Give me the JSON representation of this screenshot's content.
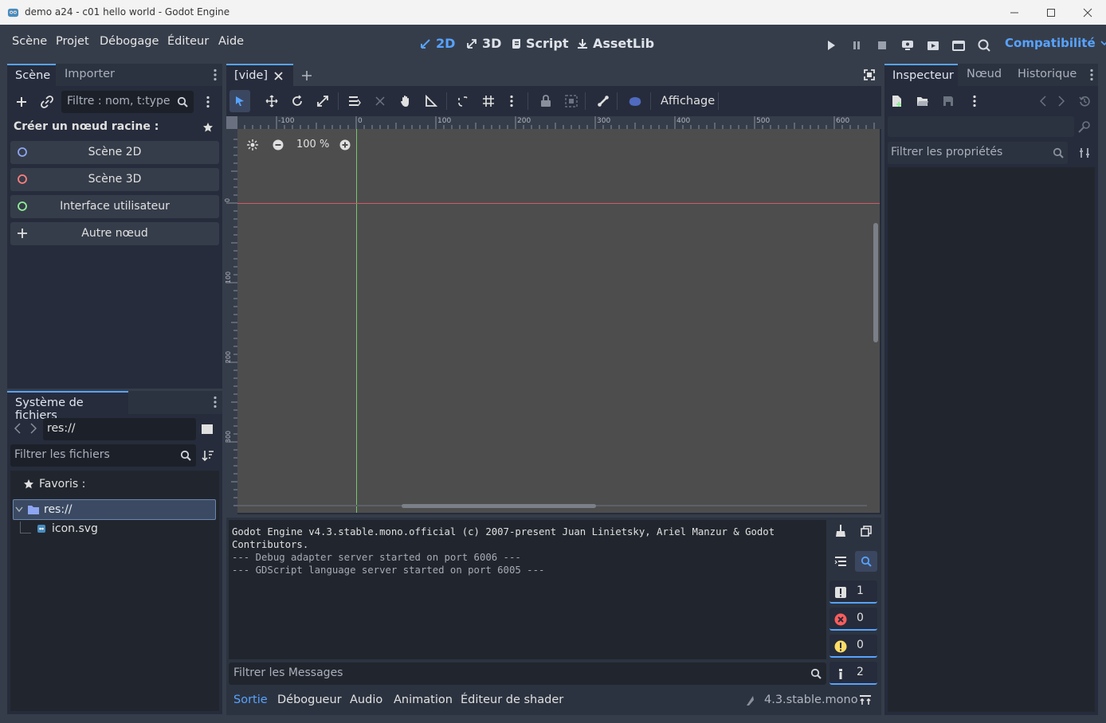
{
  "window": {
    "title": "demo a24 - c01 hello world - Godot Engine"
  },
  "menu": {
    "items": [
      "Scène",
      "Projet",
      "Débogage",
      "Éditeur",
      "Aide"
    ]
  },
  "modes": {
    "m2d": "2D",
    "m3d": "3D",
    "script": "Script",
    "assetlib": "AssetLib"
  },
  "renderer": "Compatibilité",
  "scene_dock": {
    "tabs": [
      "Scène",
      "Importer"
    ],
    "filter_placeholder": "Filtre : nom, t:type, g",
    "create_root_label": "Créer un nœud racine :",
    "buttons": [
      "Scène 2D",
      "Scène 3D",
      "Interface utilisateur",
      "Autre nœud"
    ]
  },
  "filesystem": {
    "tab": "Système de fichiers",
    "path": "res://",
    "filter_placeholder": "Filtrer les fichiers",
    "favorites": "Favoris :",
    "root": "res://",
    "files": [
      "icon.svg"
    ]
  },
  "editor": {
    "tab": "[vide]",
    "view_menu": "Affichage",
    "zoom": "100 %",
    "ruler_h": [
      "-100",
      "0",
      "100",
      "200",
      "300",
      "400",
      "500",
      "600"
    ],
    "ruler_v": [
      "0",
      "100",
      "200",
      "300"
    ]
  },
  "inspector": {
    "tabs": [
      "Inspecteur",
      "Nœud",
      "Historique"
    ],
    "filter_placeholder": "Filtrer les propriétés"
  },
  "output": {
    "lines": [
      "Godot Engine v4.3.stable.mono.official (c) 2007-present Juan Linietsky, Ariel Manzur & Godot",
      "Contributors.",
      "--- Debug adapter server started on port 6006 ---",
      "--- GDScript language server started on port 6005 ---"
    ],
    "filter_placeholder": "Filtrer les Messages",
    "counts": {
      "messages": "1",
      "errors": "0",
      "warnings": "0",
      "editor": "2"
    }
  },
  "bottom_tabs": [
    "Sortie",
    "Débogueur",
    "Audio",
    "Animation",
    "Éditeur de shader"
  ],
  "version": "4.3.stable.mono",
  "colors": {
    "accent": "#57a3ff",
    "background": "#363d4a",
    "panel": "#262c3b",
    "viewport": "#4d4d4d"
  }
}
